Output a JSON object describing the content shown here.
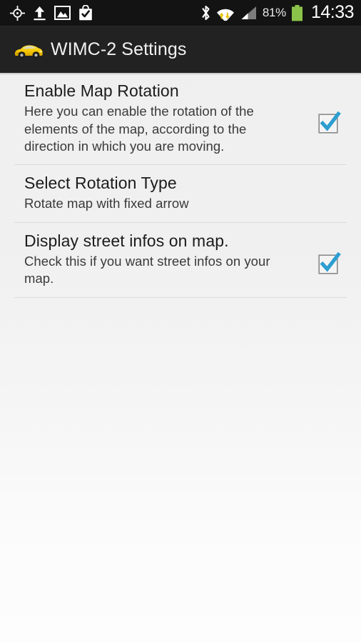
{
  "status_bar": {
    "left_icons": [
      {
        "name": "gps-location-icon",
        "label": "GPS location"
      },
      {
        "name": "upload-icon",
        "label": "Upload in progress"
      },
      {
        "name": "image-gallery-icon",
        "label": "Screenshot captured"
      },
      {
        "name": "play-store-bag-icon",
        "label": "App installed"
      }
    ],
    "right_icons": [
      {
        "name": "bluetooth-icon",
        "label": "Bluetooth on"
      },
      {
        "name": "wifi-icon",
        "label": "Wi-Fi connected, data transfer"
      },
      {
        "name": "cellular-signal-icon",
        "label": "Cellular signal"
      }
    ],
    "battery_percent": "81%",
    "battery_color": "#8bc34a",
    "wifi_arrow_color": "#e8c200",
    "clock": "14:33"
  },
  "action_bar": {
    "icon": "sports-car-icon",
    "title": "WIMC-2 Settings",
    "background_color": "#222222",
    "title_color": "#f2f2f2"
  },
  "preferences": [
    {
      "title": "Enable Map Rotation",
      "summary": "Here you can enable the rotation of the elements of the map, according to the direction in which you are moving.",
      "widget": "checkbox",
      "checked": true
    },
    {
      "title": "Select Rotation Type",
      "summary": "Rotate map with fixed arrow",
      "widget": "none",
      "checked": null
    },
    {
      "title": "Display street infos on map.",
      "summary": "Check this if you want street infos on your map.",
      "widget": "checkbox",
      "checked": true
    }
  ],
  "theme": {
    "checkbox_check_color": "#2d9ed0",
    "checkbox_border_color": "#8a8a8a",
    "checkbox_fill_color": "#f4f4f4",
    "divider_color": "#dbdbdb",
    "page_background_top": "#efefef",
    "page_background_bottom": "#fdfdfd"
  }
}
